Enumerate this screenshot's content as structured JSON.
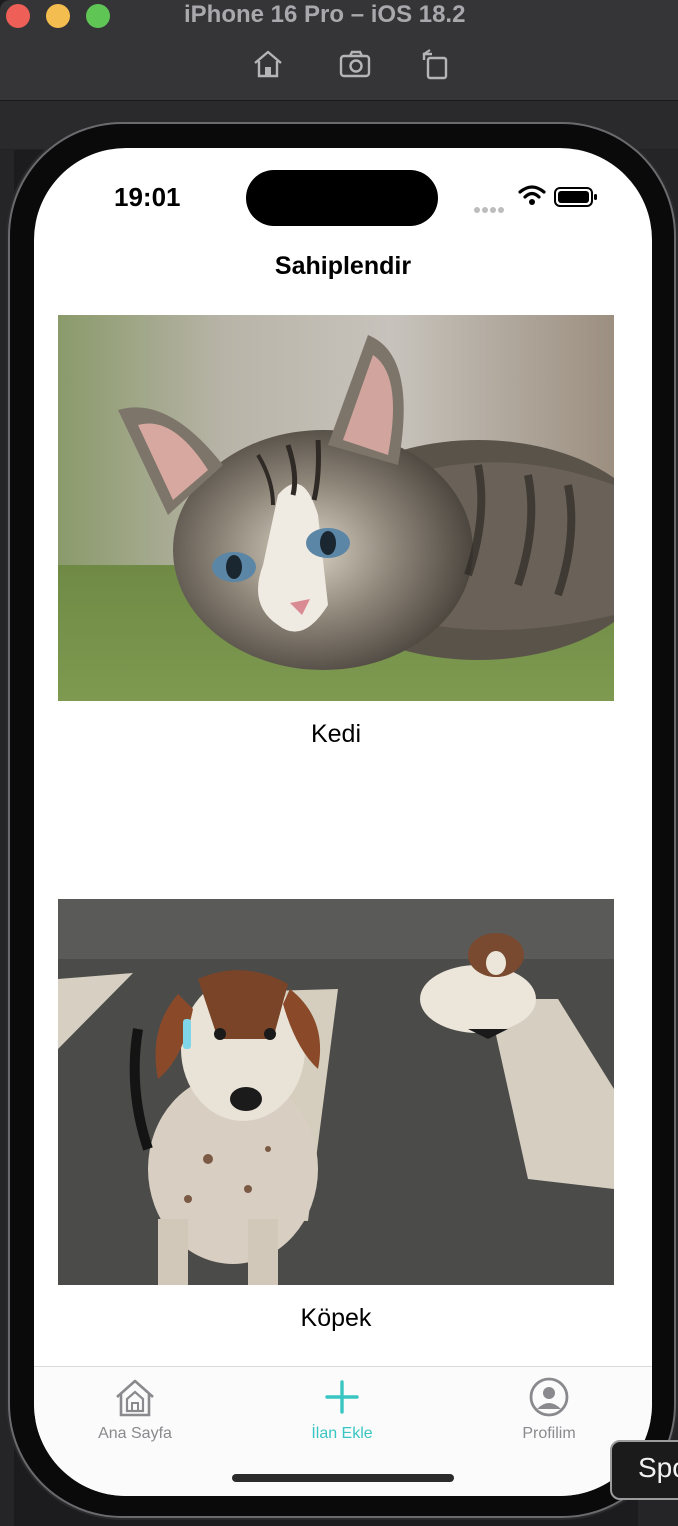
{
  "window": {
    "title": "iPhone 16 Pro – iOS 18.2",
    "toolbar": [
      "home-icon",
      "screenshot-icon",
      "rotate-icon"
    ]
  },
  "status_bar": {
    "time": "19:01"
  },
  "screen": {
    "nav_title": "Sahiplendir",
    "pets": [
      {
        "label": "Kedi",
        "image": "kitten-photo"
      },
      {
        "label": "Köpek",
        "image": "dogs-on-crosswalk-photo"
      }
    ]
  },
  "tab_bar": {
    "tabs": [
      {
        "label": "Ana Sayfa",
        "icon": "home-icon",
        "active": false
      },
      {
        "label": "İlan Ekle",
        "icon": "plus-icon",
        "active": true
      },
      {
        "label": "Profilim",
        "icon": "profile-icon",
        "active": false
      }
    ],
    "accent_color": "#39c6c2"
  },
  "overlay": {
    "spotlight_text": "Spo"
  }
}
